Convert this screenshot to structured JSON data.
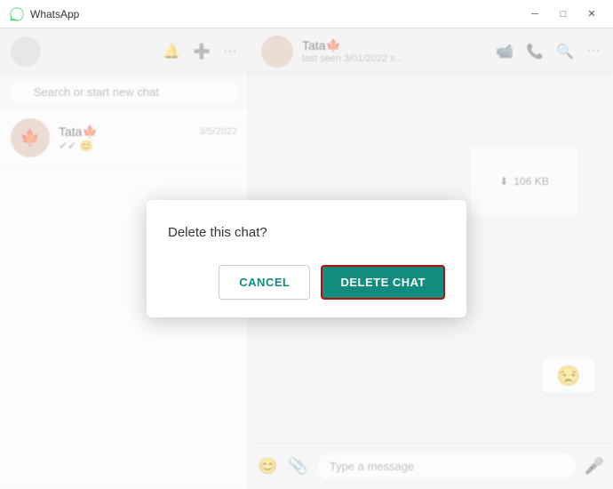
{
  "titleBar": {
    "appName": "WhatsApp",
    "minimizeLabel": "─",
    "maximizeLabel": "□",
    "closeLabel": "✕"
  },
  "sidebar": {
    "searchPlaceholder": "Search or start new chat",
    "chat": {
      "name": "Tata🍁",
      "time": "3/5/2022",
      "preview": "✔✔ 😊"
    }
  },
  "chatPanel": {
    "contactName": "Tata🍁",
    "lastSeen": "last seen 3/01/2022 s...",
    "downloadSize": "106 KB",
    "inputPlaceholder": "Type a message",
    "emoji": "😒"
  },
  "dialog": {
    "title": "Delete this chat?",
    "cancelLabel": "CANCEL",
    "deleteLabel": "DELETE CHAT"
  }
}
